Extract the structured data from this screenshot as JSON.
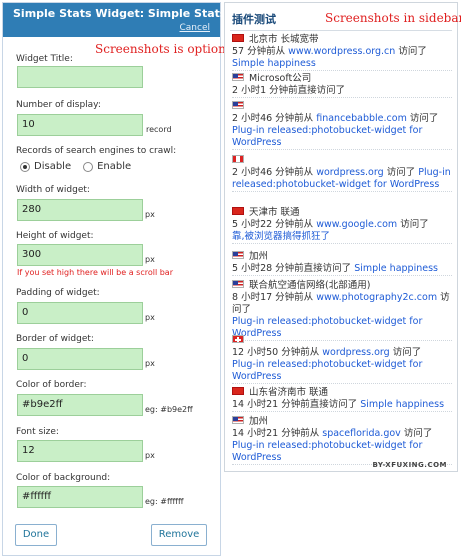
{
  "option_panel": {
    "title": "Simple Stats Widget: Simple Stats",
    "cancel_label": "Cancel",
    "annotation": "Screenshots is option",
    "widget_title_label": "Widget Title:",
    "widget_title_value": "",
    "number_display_label": "Number of display:",
    "number_display_value": "10",
    "number_display_unit": "record",
    "crawl_label": "Records of search engines to crawl:",
    "crawl_options": [
      "Disable",
      "Enable"
    ],
    "crawl_selected": "Disable",
    "width_label": "Width of widget:",
    "width_value": "280",
    "width_unit": "px",
    "height_label": "Height of widget:",
    "height_value": "300",
    "height_unit": "px",
    "height_hint": "If you set high there will be a scroll bar",
    "padding_label": "Padding of widget:",
    "padding_value": "0",
    "padding_unit": "px",
    "border_label": "Border of widget:",
    "border_value": "0",
    "border_unit": "px",
    "border_color_label": "Color of border:",
    "border_color_value": "#b9e2ff",
    "border_color_eg": "eg: #b9e2ff",
    "font_size_label": "Font size:",
    "font_size_value": "12",
    "font_size_unit": "px",
    "bg_color_label": "Color of background:",
    "bg_color_value": "#ffffff",
    "bg_color_eg": "eg: #ffffff",
    "done_label": "Done",
    "remove_label": "Remove"
  },
  "sidebar": {
    "title": "插件测试",
    "annotation": "Screenshots in sidebar",
    "credit": "BY-XFUXING.COM",
    "entries": [
      {
        "flag": "cn",
        "location": "北京市 长城宽带",
        "time": "57 分钟前从",
        "source": "www.wordpress.org.cn",
        "action": "访问了",
        "page": "Simple happiness"
      },
      {
        "flag": "us",
        "location": "Microsoft公司",
        "time": "2 小时1 分钟前直接访问了",
        "source": "",
        "action": "",
        "page": ""
      },
      {
        "flag": "us",
        "location": "",
        "time": "2 小时46 分钟前从",
        "source": "financebabble.com",
        "action": "访问了",
        "page": "Plug-in released:photobucket-widget for WordPress"
      },
      {
        "flag": "ca",
        "location": "",
        "time": "2 小时46 分钟前从",
        "source": "wordpress.org",
        "action": "访问了",
        "page": "Plug-in released:photobucket-widget for WordPress"
      },
      {
        "flag": "cn",
        "location": "天津市 联通",
        "time": "5 小时22 分钟前从",
        "source": "www.google.com",
        "action": "访问了",
        "page": "靠,被浏览器搞得抓狂了"
      },
      {
        "flag": "us",
        "location": "加州",
        "time": "5 小时28 分钟前直接访问了",
        "source": "",
        "action": "",
        "page": "Simple happiness"
      },
      {
        "flag": "us",
        "location": "联合航空通信网络(北部通用)",
        "time": "8 小时17 分钟前从",
        "source": "www.photography2c.com",
        "action": "访问了",
        "page": "Plug-in released:photobucket-widget for WordPress"
      },
      {
        "flag": "ch",
        "location": "",
        "time": "12 小时50 分钟前从",
        "source": "wordpress.org",
        "action": "访问了",
        "page": "Plug-in released:photobucket-widget for WordPress"
      },
      {
        "flag": "cn",
        "location": "山东省济南市 联通",
        "time": "14 小时21 分钟前直接访问了",
        "source": "",
        "action": "",
        "page": "Simple happiness"
      },
      {
        "flag": "us",
        "location": "加州",
        "time": "14 小时21 分钟前从",
        "source": "spaceflorida.gov",
        "action": "访问了",
        "page": "Plug-in released:photobucket-widget for WordPress"
      }
    ]
  }
}
